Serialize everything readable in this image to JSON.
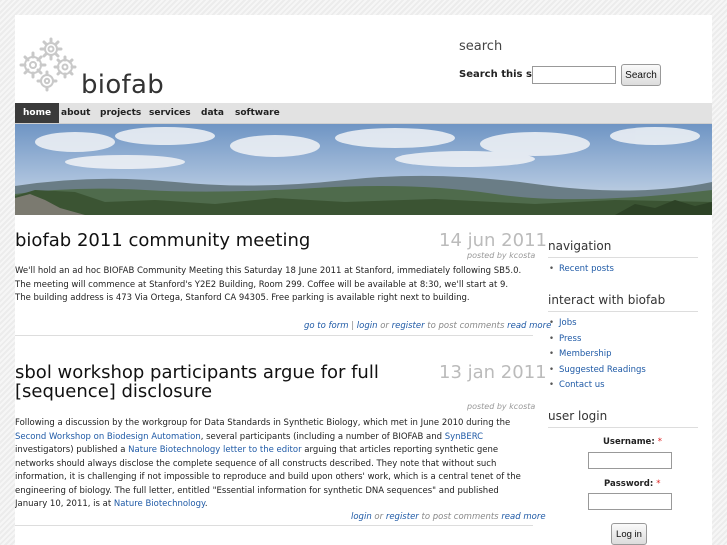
{
  "site": {
    "name": "biofab"
  },
  "search": {
    "title": "search",
    "label": "Search this site:",
    "input_value": "",
    "button_label": "Search"
  },
  "nav": {
    "items": [
      {
        "label": "home",
        "active": true
      },
      {
        "label": "about"
      },
      {
        "label": "projects"
      },
      {
        "label": "services"
      },
      {
        "label": "data"
      },
      {
        "label": "software"
      }
    ]
  },
  "posts": [
    {
      "title": "biofab 2011 community meeting",
      "date": "14 jun 2011",
      "meta": "posted by kcosta",
      "body": "We'll hold an ad hoc BIOFAB Community Meeting this Saturday 18 June 2011 at Stanford, immediately following SB5.0. The meeting will commence at Stanford's Y2E2 Building, Room 299. Coffee will be available at 8:30, we'll start at 9. The building address is 473 Via Ortega, Stanford CA 94305. Free parking is available right next to building.",
      "links": {
        "go_to_forum": "go to form",
        "sep1": " | ",
        "login": "login",
        "or": " or ",
        "register": "register",
        "to_post": " to post comments ",
        "read_more": "read more"
      }
    },
    {
      "title_line1": "sbol workshop participants argue for full",
      "title_line2": "[sequence] disclosure",
      "date": "13 jan 2011",
      "meta": "posted by kcosta",
      "body": {
        "t1": "Following a discussion by the workgroup for Data Standards in Synthetic Biology, which met in June 2010 during the ",
        "l1": "Second Workshop on Biodesign Automation",
        "t2": ", several participants (including a number of BIOFAB and ",
        "l2": "SynBERC",
        "t3": " investigators) published a ",
        "l3": "Nature Biotechnology letter to the editor",
        "t4": " arguing that articles reporting synthetic gene networks should always disclose the complete sequence of all constructs described. They note that without such information, it is challenging if not impossible to reproduce and build upon others' work, which is a central tenet of the engineering of biology. The full letter, entitled \"Essential information for synthetic DNA sequences\" and published January 10, 2011, is at ",
        "l4": "Nature Biotechnology",
        "t5": "."
      },
      "links": {
        "login": "login",
        "or": " or ",
        "register": "register",
        "to_post": " to post comments ",
        "read_more": "read more"
      }
    }
  ],
  "sidebar": {
    "navigation": {
      "title": "navigation",
      "items": [
        "Recent posts"
      ]
    },
    "interact": {
      "title": "interact with biofab",
      "items": [
        "Jobs",
        "Press",
        "Membership",
        "Suggested Readings",
        "Contact us"
      ]
    },
    "login": {
      "title": "user login",
      "username_label": "Username:",
      "password_label": "Password:",
      "required_mark": "*",
      "username_value": "",
      "password_value": "",
      "button_label": "Log in"
    }
  },
  "colors": {
    "link": "#1f5aa6",
    "nav_active_bg": "#3a3a3a",
    "required": "#dd2222"
  }
}
